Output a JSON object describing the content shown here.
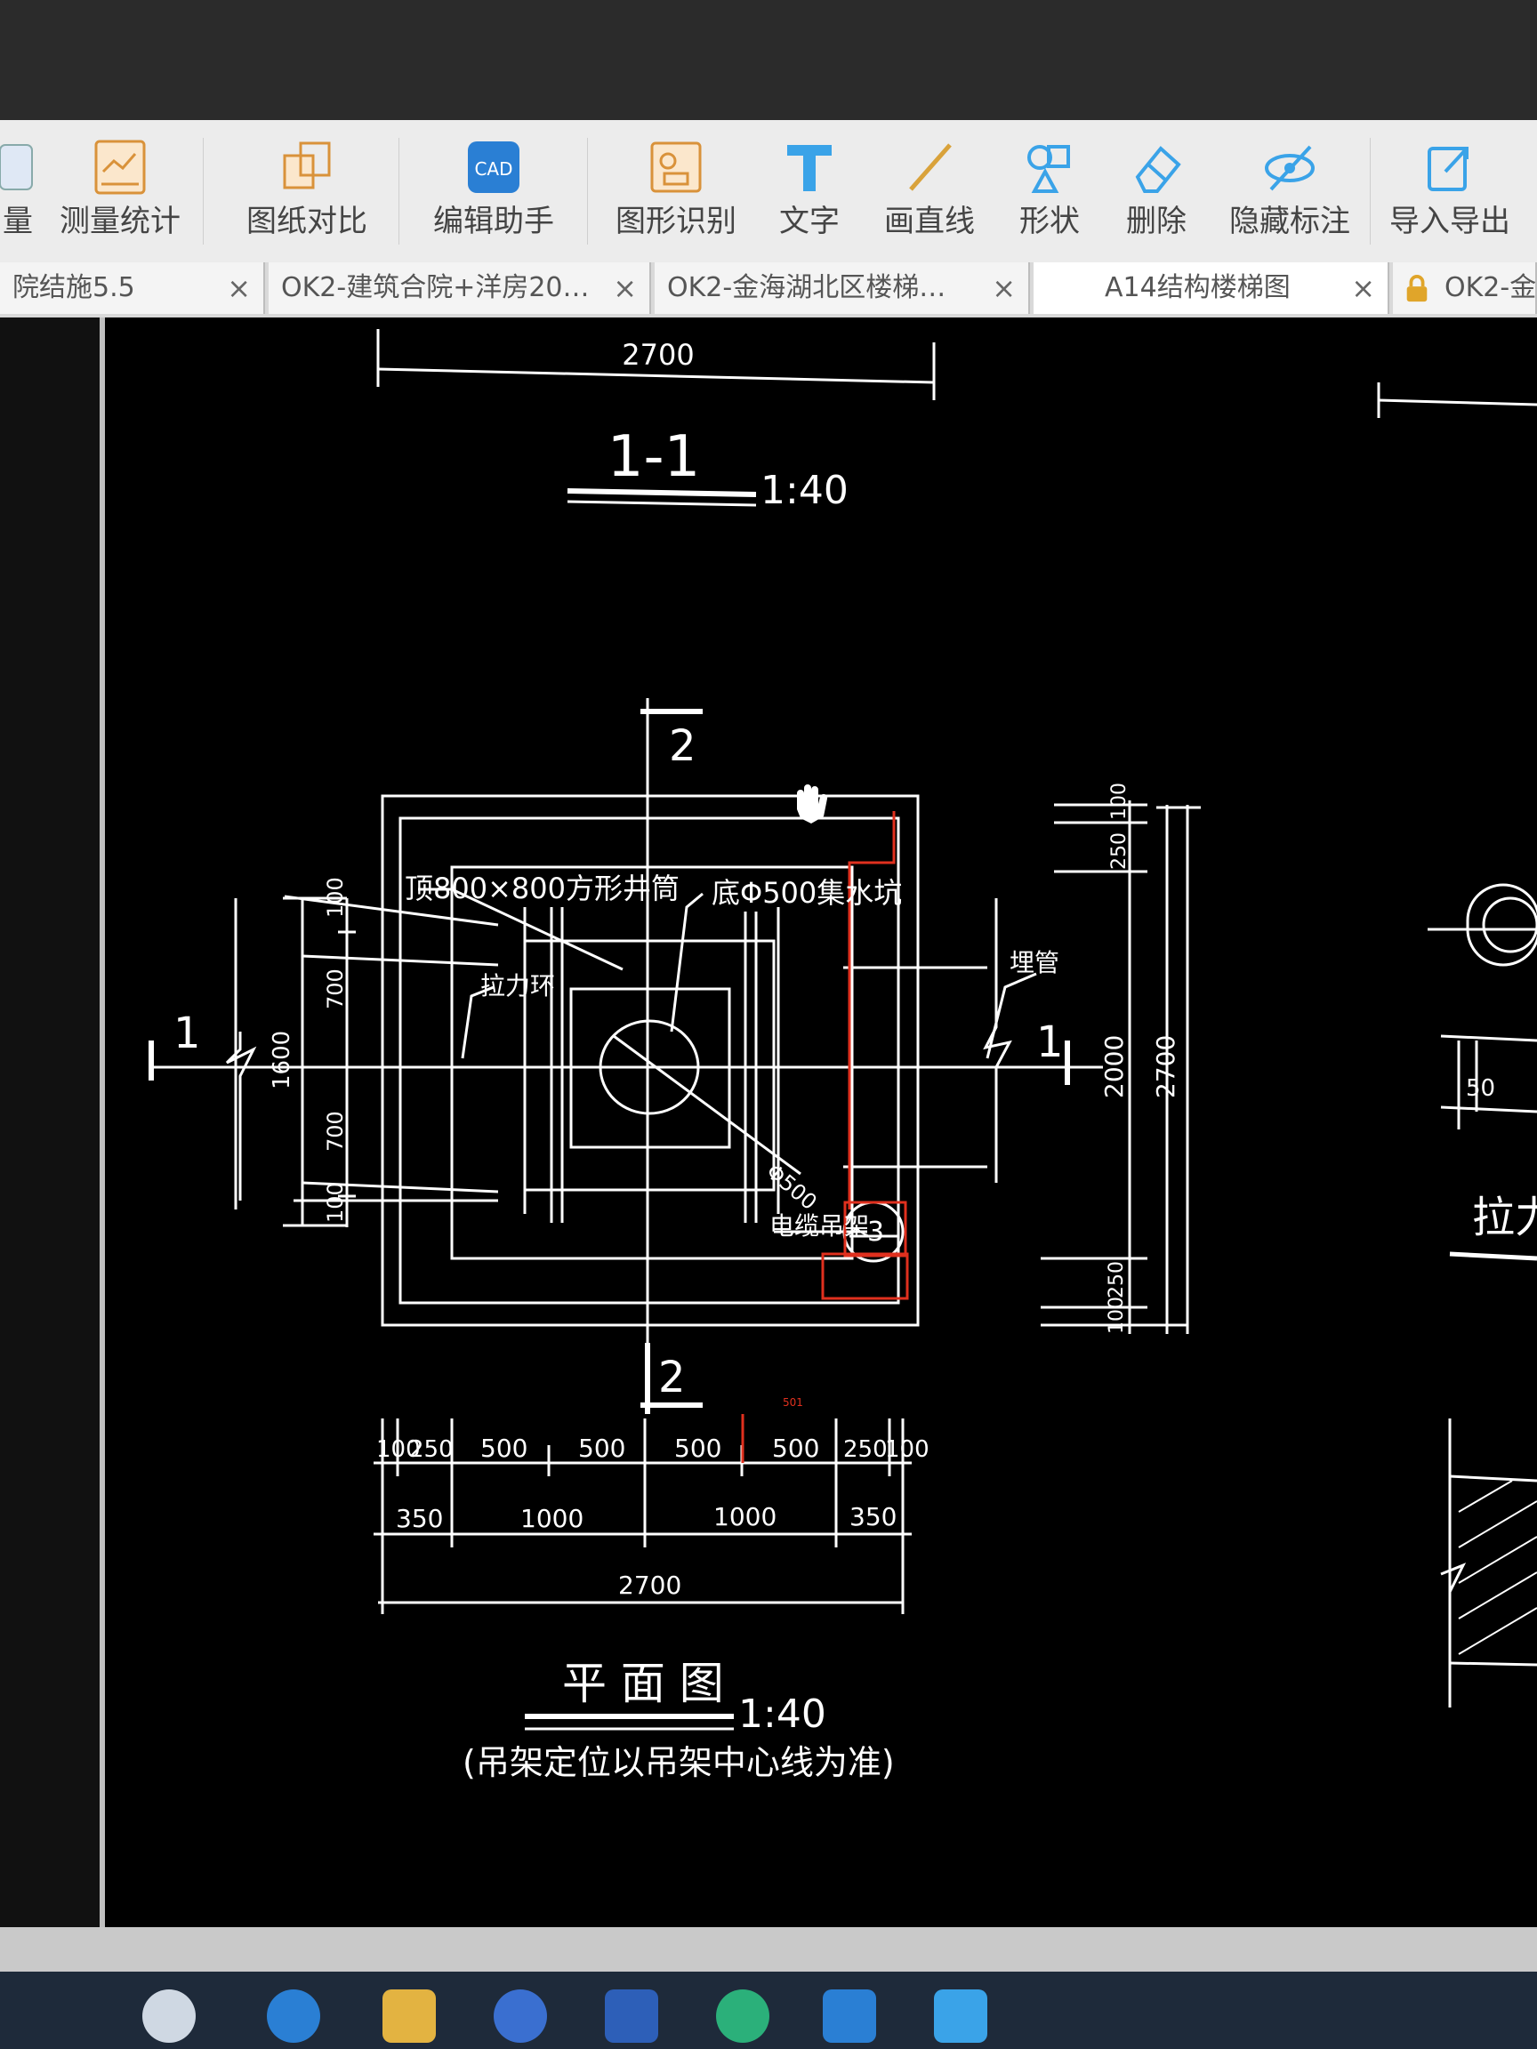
{
  "ribbon": {
    "items": [
      {
        "label": "量",
        "icon": "partial-tool-icon"
      },
      {
        "label": "测量统计",
        "icon": "measure-statistics-icon"
      },
      {
        "label": "图纸对比",
        "icon": "drawing-compare-icon"
      },
      {
        "label": "编辑助手",
        "icon": "cad-edit-helper-icon"
      },
      {
        "label": "图形识别",
        "icon": "shape-recognition-icon"
      },
      {
        "label": "文字",
        "icon": "text-tool-icon"
      },
      {
        "label": "画直线",
        "icon": "draw-line-icon"
      },
      {
        "label": "形状",
        "icon": "shape-icon"
      },
      {
        "label": "删除",
        "icon": "eraser-delete-icon"
      },
      {
        "label": "隐藏标注",
        "icon": "hide-annotation-icon"
      },
      {
        "label": "导入导出",
        "icon": "import-export-icon"
      }
    ]
  },
  "tabs": [
    {
      "label": "院结施5.5",
      "close": "×"
    },
    {
      "label": "OK2-建筑合院+洋房20…",
      "close": "×"
    },
    {
      "label": "OK2-金海湖北区楼梯…",
      "close": "×"
    },
    {
      "label": "A14结构楼梯图",
      "close": "×"
    },
    {
      "label": "OK2-金",
      "close": "",
      "locked": true
    }
  ],
  "drawing": {
    "top_dim": "2700",
    "section_title": "1-1",
    "section_scale": "1:40",
    "marker_2": "2",
    "marker_1": "1",
    "label_well": "顶800×800方形井筒",
    "label_sump": "底Φ500集水坑",
    "label_ring": "拉力环",
    "label_pipe": "埋管",
    "label_phi": "Φ500",
    "label_cable": "电缆吊架",
    "label_detail": "3",
    "left_dims": [
      "100",
      "700",
      "700",
      "100"
    ],
    "left_total": "1600",
    "right_dims_top": [
      "100",
      "250"
    ],
    "right_dims_bottom": [
      "250",
      "100"
    ],
    "right_mid": "2000",
    "right_total": "2700",
    "bottom_row1": [
      "100",
      "250",
      "500",
      "500",
      "500",
      "500",
      "250",
      "100"
    ],
    "bottom_row2": [
      "350",
      "1000",
      "1000",
      "350"
    ],
    "bottom_total": "2700",
    "red_dim": "501",
    "plan_title": "平 面 图",
    "plan_scale": "1:40",
    "plan_note": "(吊架定位以吊架中心线为准)",
    "right_partial_dim": "50",
    "right_partial_label": "拉力",
    "colors": {
      "line": "#ffffff",
      "red": "#e0301e"
    }
  }
}
